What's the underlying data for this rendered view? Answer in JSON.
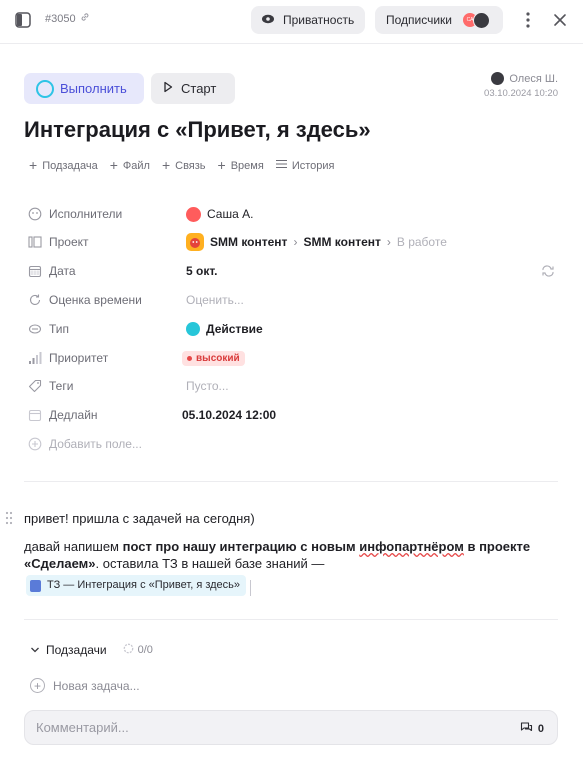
{
  "topbar": {
    "task_id": "#3050",
    "privacy_label": "Приватность",
    "subscribers_label": "Подписчики",
    "subscriber_initials": "СА"
  },
  "actions": {
    "execute_label": "Выполнить",
    "start_label": "Старт"
  },
  "author": {
    "name": "Олеся Ш.",
    "date": "03.10.2024 10:20"
  },
  "title": "Интеграция с «Привет, я здесь»",
  "quick_actions": [
    {
      "label": "Подзадача"
    },
    {
      "label": "Файл"
    },
    {
      "label": "Связь"
    },
    {
      "label": "Время"
    },
    {
      "label": "История"
    }
  ],
  "properties": {
    "assignees": {
      "label": "Исполнители",
      "value": "Саша А."
    },
    "project": {
      "label": "Проект",
      "crumb1": "SMM контент",
      "crumb2": "SMM контент",
      "crumb3": "В работе"
    },
    "date": {
      "label": "Дата",
      "value": "5 окт."
    },
    "estimate": {
      "label": "Оценка времени",
      "value": "Оценить..."
    },
    "type": {
      "label": "Тип",
      "value": "Действие"
    },
    "priority": {
      "label": "Приоритет",
      "value": "высокий"
    },
    "tags": {
      "label": "Теги",
      "value": "Пусто..."
    },
    "deadline": {
      "label": "Дедлайн",
      "value": "05.10.2024 12:00"
    },
    "add_field": "Добавить поле..."
  },
  "description": {
    "line1": "привет! пришла с задачей на сегодня)",
    "p2_a": "давай напишем ",
    "p2_bold1": "пост про нашу интеграцию с новым ",
    "p2_bold_err": "инфопартнёром",
    "p2_bold2": " в проекте «Сделаем»",
    "p2_b": ". оставила ТЗ в нашей базе знаний —",
    "doc_link": "ТЗ — Интеграция с «Привет, я здесь»"
  },
  "subtasks": {
    "label": "Подзадачи",
    "count": "0/0",
    "new_task": "Новая задача..."
  },
  "comment": {
    "placeholder": "Комментарий...",
    "count": "0"
  },
  "colors": {
    "accent": "#4b4fd8",
    "priority_high": "#d93b3b",
    "ring": "#2ec4e6"
  }
}
